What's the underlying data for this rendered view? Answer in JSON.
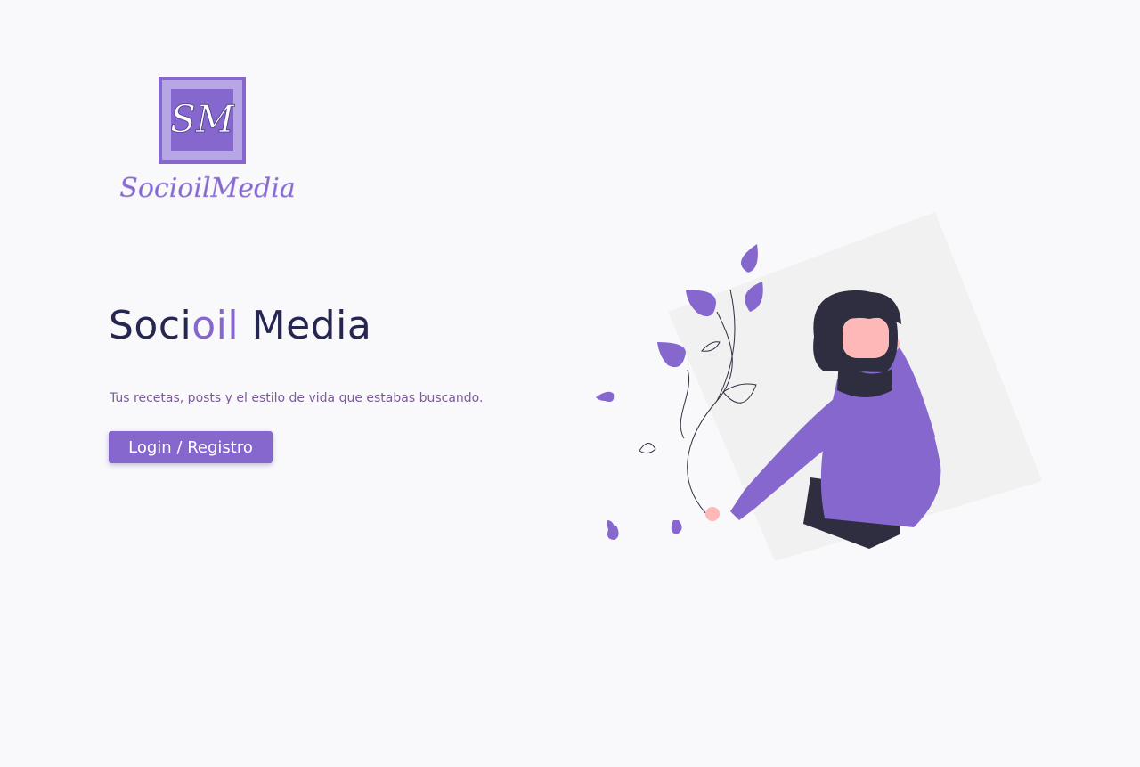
{
  "brand": {
    "logo_monogram": "SM",
    "logo_wordmark": "SocioilMedia"
  },
  "hero": {
    "title_part1": "Soci",
    "title_accent": "oil",
    "title_part2": " Media",
    "tagline": "Tus recetas, posts y el estilo de vida que estabas buscando.",
    "cta_label": "Login / Registro"
  },
  "colors": {
    "accent": "#8567cd",
    "title": "#262750",
    "tagline": "#7a5b98",
    "background": "#f9f9fc"
  },
  "illustration": {
    "icon": "woman-with-leaves-illustration"
  }
}
